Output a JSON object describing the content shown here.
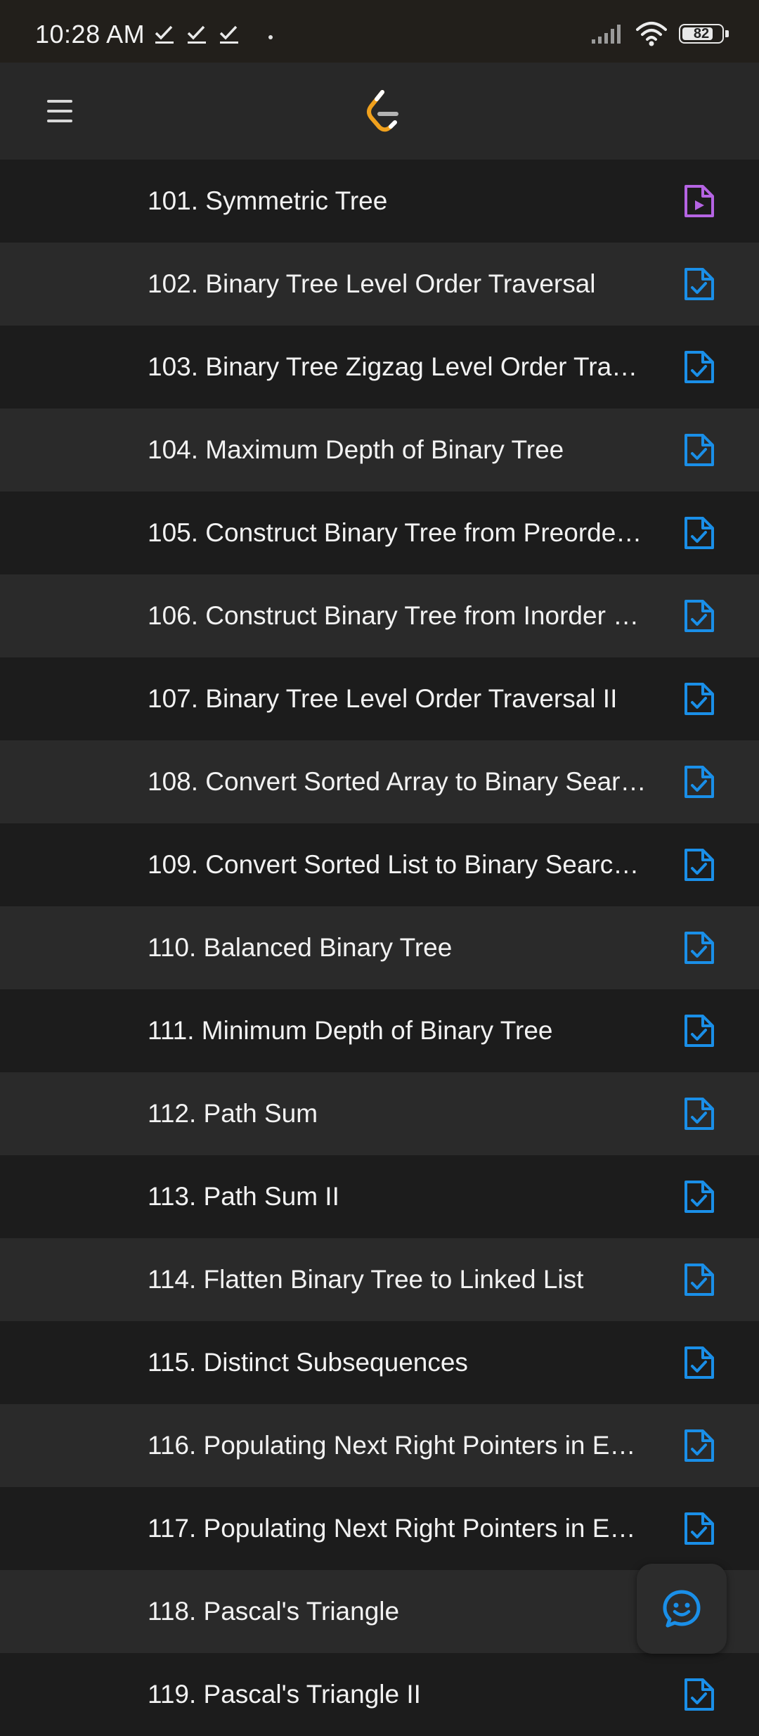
{
  "status_bar": {
    "time": "10:28 AM",
    "battery_level": 82,
    "battery_label": "82",
    "notification_icons": [
      "check-icon",
      "check-icon",
      "check-icon"
    ],
    "signal_icon": "signal-icon",
    "wifi_icon": "wifi-icon"
  },
  "app_bar": {
    "menu_icon": "hamburger-menu-icon",
    "logo_icon": "leetcode-logo-icon"
  },
  "colors": {
    "video_icon": "#b564e3",
    "solution_icon": "#1a8fe8",
    "row_dark": "#1c1c1c",
    "row_light": "#2a2a2a"
  },
  "problems": [
    {
      "title": "101. Symmetric Tree",
      "icon": "video-solution-icon"
    },
    {
      "title": "102. Binary Tree Level Order Traversal",
      "icon": "solution-doc-icon"
    },
    {
      "title": "103. Binary Tree Zigzag Level Order Trav…",
      "icon": "solution-doc-icon"
    },
    {
      "title": "104. Maximum Depth of Binary Tree",
      "icon": "solution-doc-icon"
    },
    {
      "title": "105. Construct Binary Tree from Preorde…",
      "icon": "solution-doc-icon"
    },
    {
      "title": "106. Construct Binary Tree from Inorder …",
      "icon": "solution-doc-icon"
    },
    {
      "title": "107. Binary Tree Level Order Traversal II",
      "icon": "solution-doc-icon"
    },
    {
      "title": "108. Convert Sorted Array to Binary Sear…",
      "icon": "solution-doc-icon"
    },
    {
      "title": "109. Convert Sorted List to Binary Searc…",
      "icon": "solution-doc-icon"
    },
    {
      "title": "110. Balanced Binary Tree",
      "icon": "solution-doc-icon"
    },
    {
      "title": "111. Minimum Depth of Binary Tree",
      "icon": "solution-doc-icon"
    },
    {
      "title": "112. Path Sum",
      "icon": "solution-doc-icon"
    },
    {
      "title": "113. Path Sum II",
      "icon": "solution-doc-icon"
    },
    {
      "title": "114. Flatten Binary Tree to Linked List",
      "icon": "solution-doc-icon"
    },
    {
      "title": "115. Distinct Subsequences",
      "icon": "solution-doc-icon"
    },
    {
      "title": "116. Populating Next Right Pointers in E…",
      "icon": "solution-doc-icon"
    },
    {
      "title": "117. Populating Next Right Pointers in E…",
      "icon": "solution-doc-icon"
    },
    {
      "title": "118. Pascal's Triangle",
      "icon": "solution-doc-icon"
    },
    {
      "title": "119. Pascal's Triangle II",
      "icon": "solution-doc-icon"
    }
  ],
  "fab": {
    "icon": "chat-smiley-icon"
  }
}
